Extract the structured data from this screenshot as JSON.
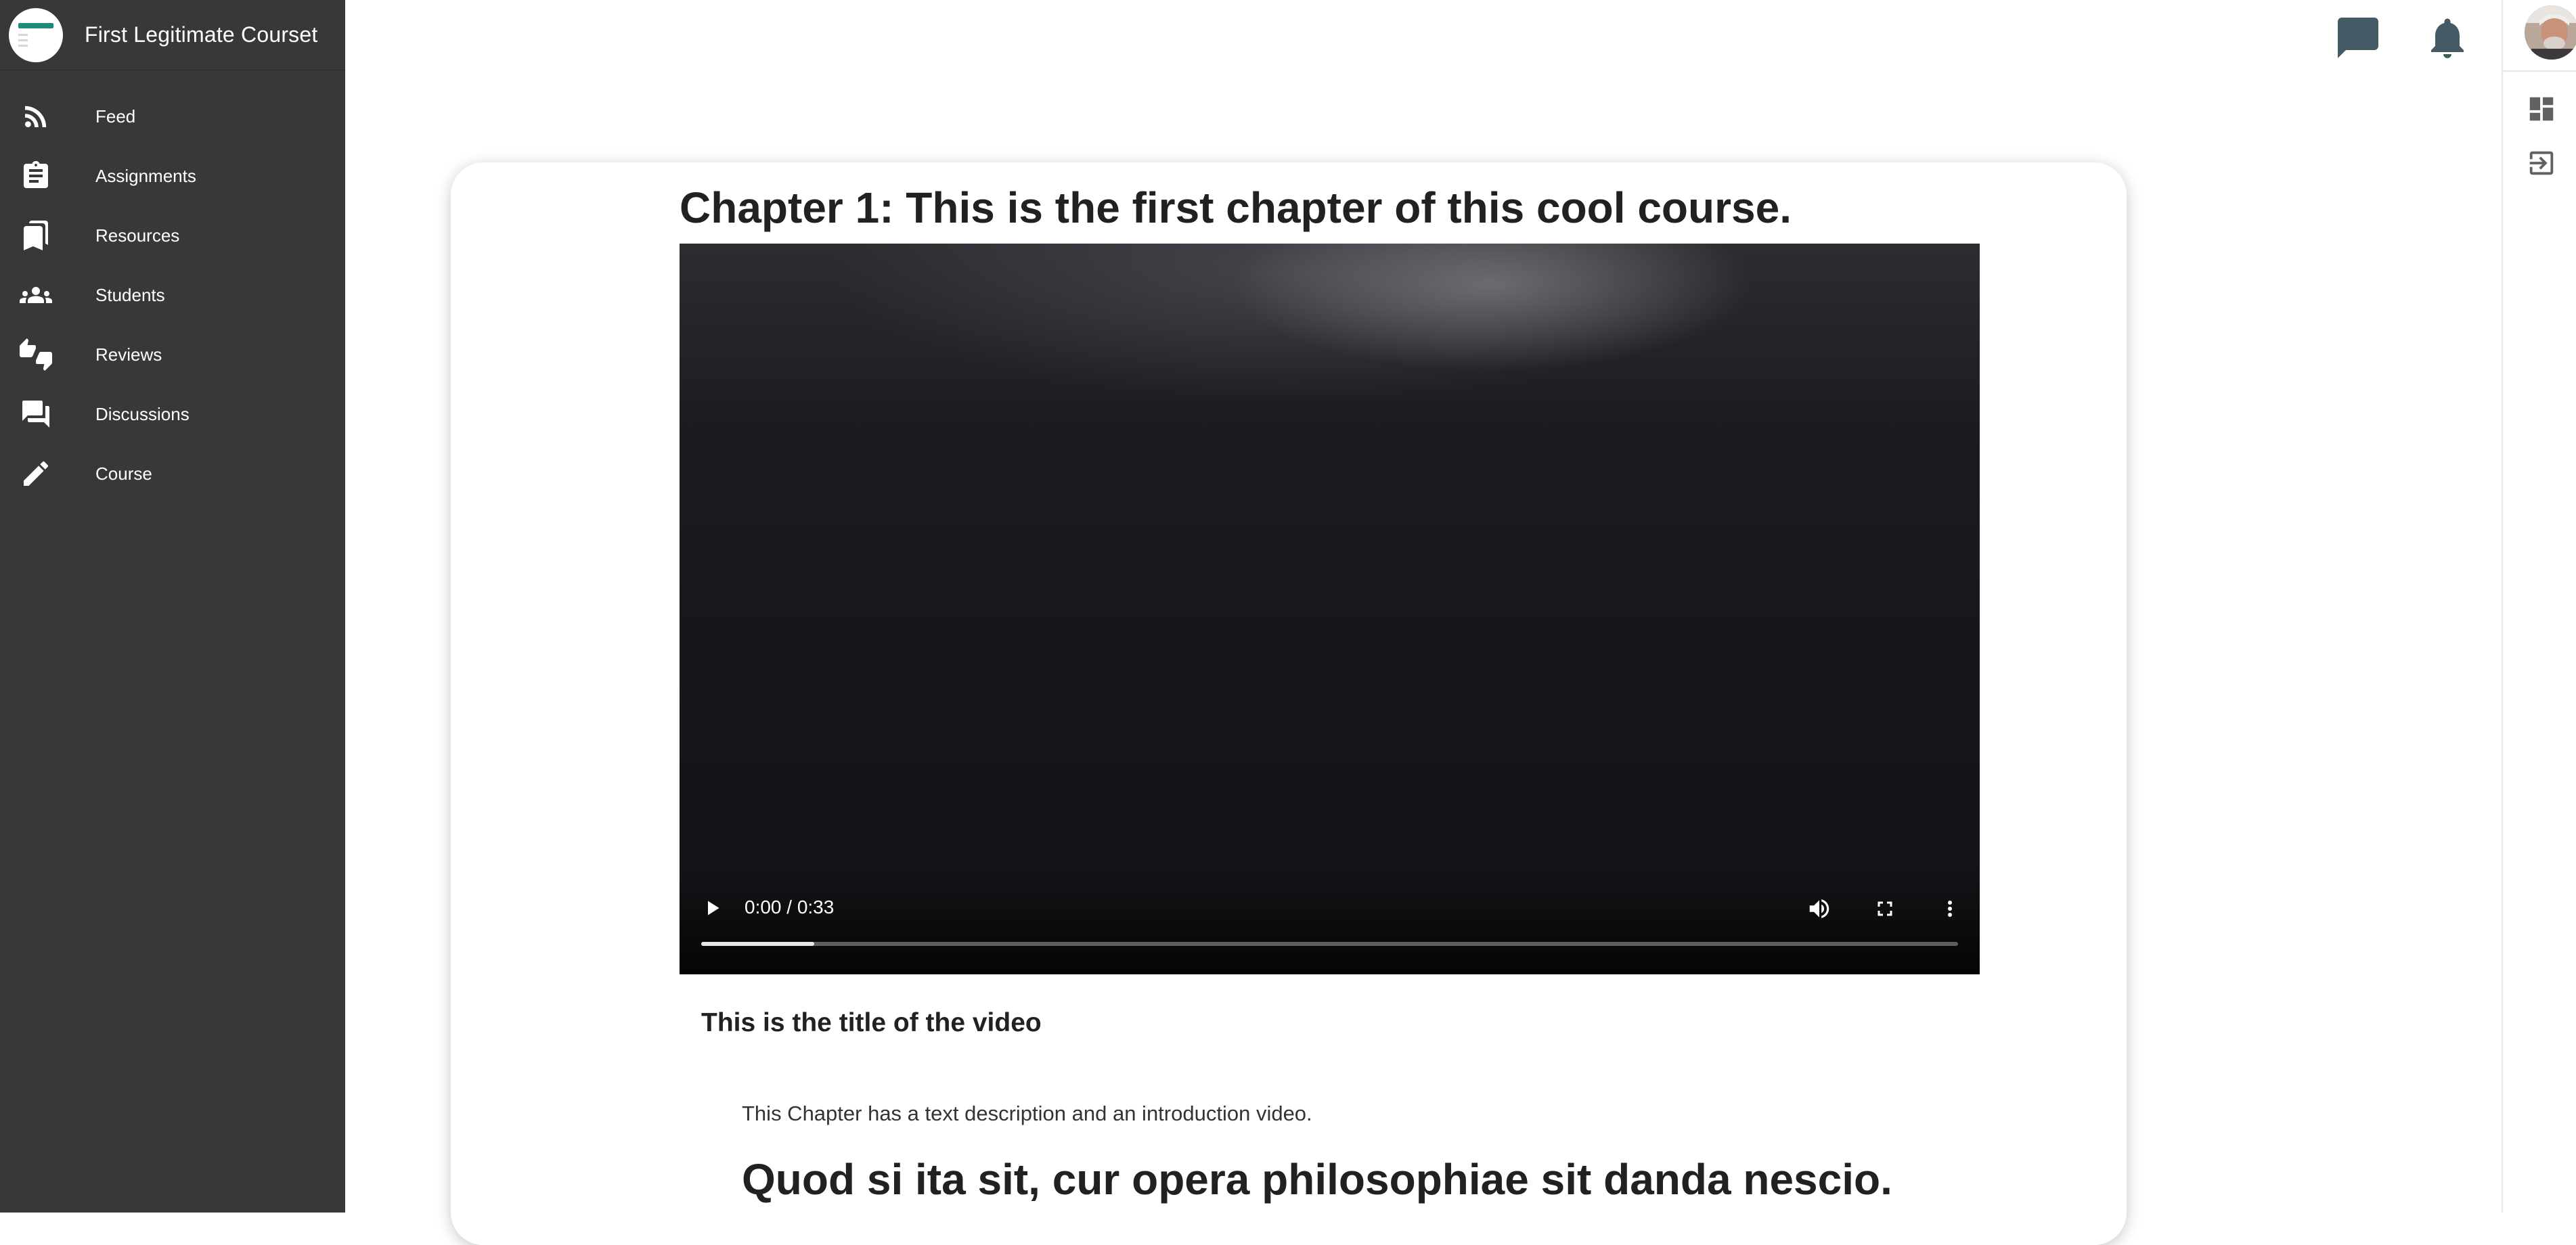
{
  "sidebar": {
    "course_title": "First Legitimate Courset",
    "items": [
      {
        "label": "Feed",
        "icon": "rss-feed-icon"
      },
      {
        "label": "Assignments",
        "icon": "clipboard-icon"
      },
      {
        "label": "Resources",
        "icon": "bookmarks-icon"
      },
      {
        "label": "Students",
        "icon": "people-icon"
      },
      {
        "label": "Reviews",
        "icon": "thumbs-up-down-icon"
      },
      {
        "label": "Discussions",
        "icon": "forum-icon"
      },
      {
        "label": "Course",
        "icon": "pencil-icon"
      }
    ]
  },
  "topbar": {
    "icons": [
      "chat-icon",
      "notification-bell-icon"
    ]
  },
  "right_rail": {
    "icons": [
      "avatar",
      "dashboard-icon",
      "logout-icon"
    ]
  },
  "content": {
    "chapter_title": "Chapter 1: This is the first chapter of this cool course.",
    "video": {
      "time_display": "0:00 / 0:33",
      "buffered_fraction": 0.09,
      "played_fraction": 0.0
    },
    "video_title": "This is the title of the video",
    "description": "This Chapter has a text description and an introduction video.",
    "body_heading": "Quod si ita sit, cur opera philosophiae sit danda nescio."
  },
  "colors": {
    "sidebar_bg": "#383838",
    "accent": "#1f8a78",
    "topbar_icon": "#455a64"
  }
}
